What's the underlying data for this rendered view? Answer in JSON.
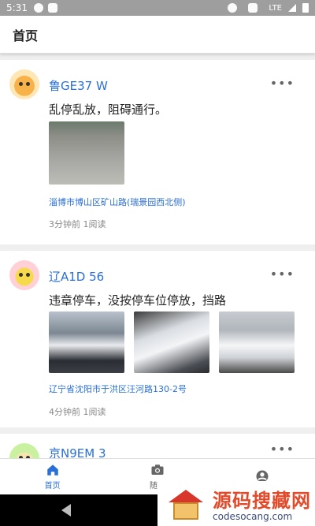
{
  "status_bar": {
    "time": "5:31",
    "network": "LTE"
  },
  "app_bar": {
    "title": "首页"
  },
  "posts": [
    {
      "plate": "鲁GE37  W",
      "content": "乱停乱放，阻碍通行。",
      "address": "淄博市博山区矿山路(瑞景园西北侧)",
      "meta": "3分钟前 1阅读",
      "avatar": "cat-avatar",
      "photos": 1
    },
    {
      "plate": "辽A1D   56",
      "content": "违章停车，没按停车位停放，挡路",
      "address": "辽宁省沈阳市于洪区汪河路130-2号",
      "meta": "4分钟前 1阅读",
      "avatar": "chick-avatar",
      "photos": 3
    },
    {
      "plate": "京N9EM  3",
      "avatar": "sprout-avatar"
    }
  ],
  "more_label": "•••",
  "bottom_nav": [
    {
      "label": "首页",
      "icon": "home-icon",
      "active": true
    },
    {
      "label": "随手",
      "icon": "camera-icon",
      "active": false
    },
    {
      "label": "",
      "icon": "profile-icon",
      "active": false
    }
  ],
  "watermark": {
    "cn": "源码搜藏网",
    "en": "codesocang.com"
  },
  "colors": {
    "accent": "#2a6fd6",
    "statusbar": "#9e9e9e"
  }
}
